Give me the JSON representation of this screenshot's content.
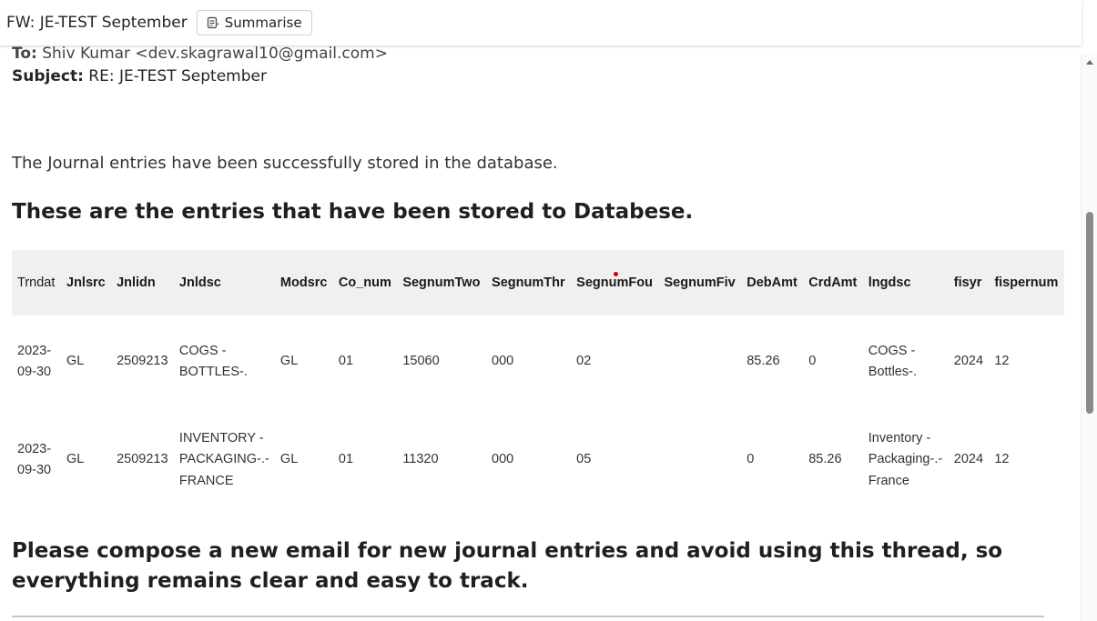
{
  "header": {
    "title": "FW: JE-TEST September",
    "summarise_label": "Summarise"
  },
  "email": {
    "to_label": "To:",
    "to_value": "Shiv Kumar <dev.skagrawal10@gmail.com>",
    "subject_label": "Subject:",
    "subject_value": "RE: JE-TEST September",
    "body_text": "The Journal entries have been successfully stored in the database.",
    "heading": "These are the entries that have been stored to Databese.",
    "closing": "Please compose a new email for new journal entries and avoid using this thread, so everything remains clear and easy to track."
  },
  "table": {
    "headers": [
      "Trndat",
      "Jnlsrc",
      "Jnlidn",
      "Jnldsc",
      "Modsrc",
      "Co_num",
      "SegnumTwo",
      "SegnumThr",
      "SegnumFou",
      "SegnumFiv",
      "DebAmt",
      "CrdAmt",
      "lngdsc",
      "fisyr",
      "fispernum"
    ],
    "rows": [
      [
        "2023-09-30",
        "GL",
        "2509213",
        "COGS - BOTTLES-.",
        "GL",
        "01",
        "15060",
        "000",
        "02",
        "",
        "85.26",
        "0",
        "COGS - Bottles-.",
        "2024",
        "12"
      ],
      [
        "2023-09-30",
        "GL",
        "2509213",
        "INVENTORY - PACKAGING-.-FRANCE",
        "GL",
        "01",
        "11320",
        "000",
        "05",
        "",
        "0",
        "85.26",
        "Inventory - Packaging-.-France",
        "2024",
        "12"
      ]
    ]
  },
  "icons": {
    "summarise": "summarise-icon",
    "scroll_up": "scroll-up-arrow-icon"
  }
}
